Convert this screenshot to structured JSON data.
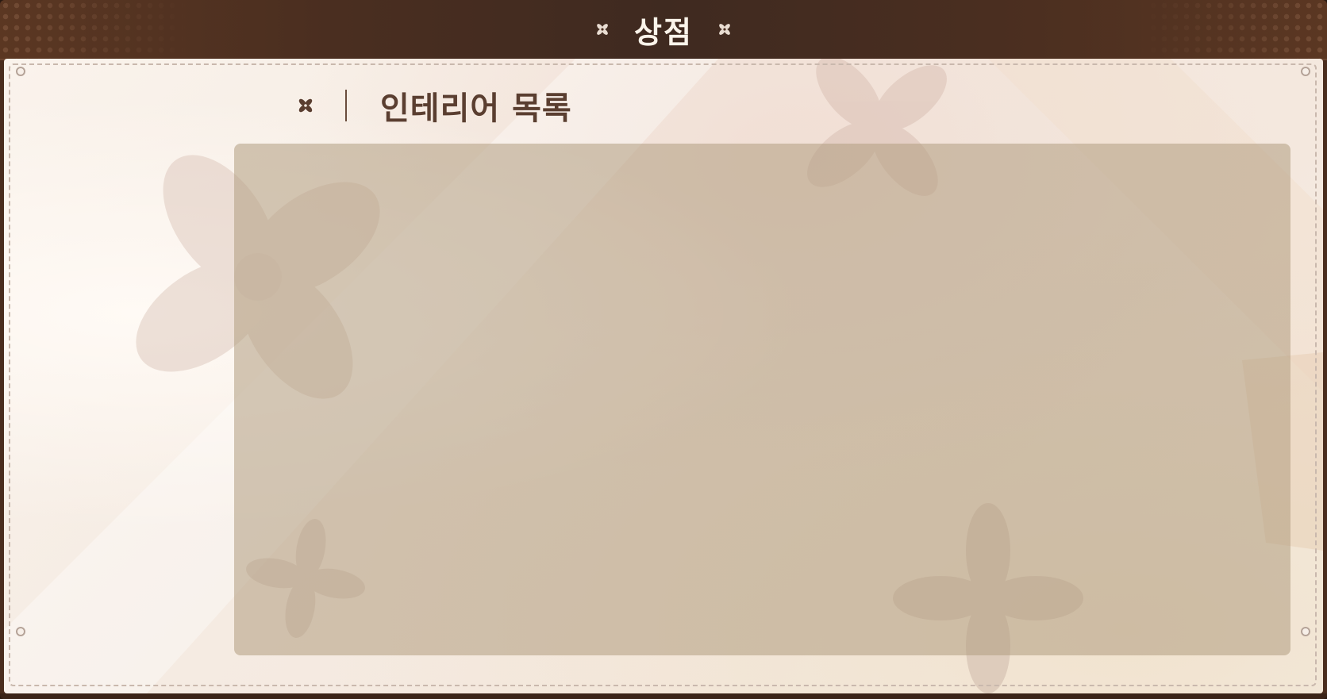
{
  "window": {
    "title": "상점"
  },
  "section": {
    "title": "인테리어 목록"
  },
  "interior_list": {
    "items": []
  },
  "colors": {
    "titlebar": "#4a2e20",
    "title_text": "#fbf4ea",
    "panel_bg": "#f5ebe2",
    "section_title": "#5a3e30",
    "list_area": "#cbbeab",
    "dashed_border": "#c9b8ad"
  },
  "icons": {
    "title_left": "four-petal-ornament-icon",
    "title_right": "four-petal-ornament-icon",
    "section_marker": "four-petal-ornament-icon"
  }
}
